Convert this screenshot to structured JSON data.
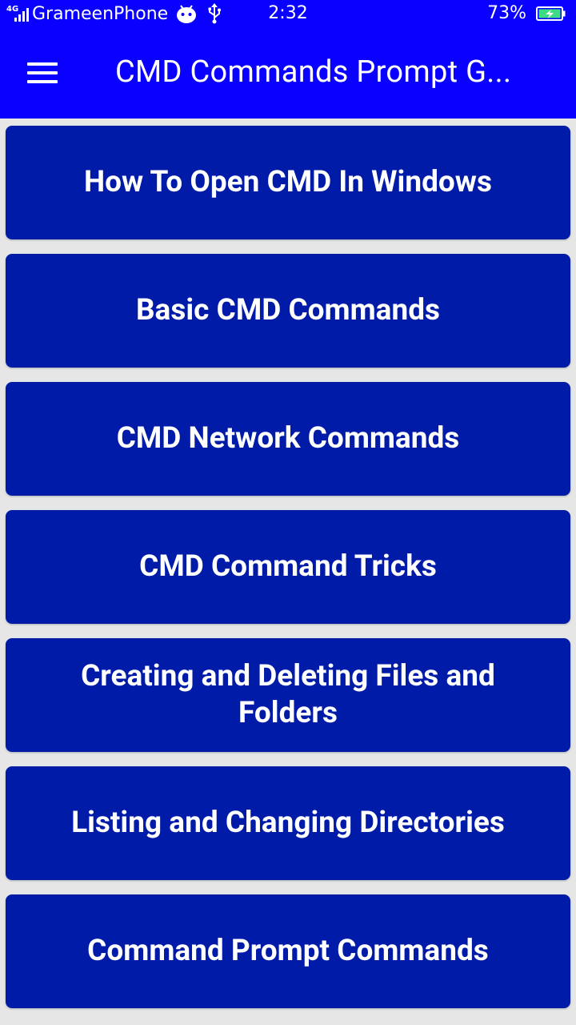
{
  "status_bar": {
    "network_type": "4G",
    "carrier": "GrameenPhone",
    "time": "2:32",
    "battery_percent": "73%",
    "icons": [
      "signal-icon",
      "android-icon",
      "usb-icon",
      "battery-charging-icon"
    ]
  },
  "app_bar": {
    "title": "CMD Commands Prompt G...",
    "menu_icon": "hamburger-menu-icon"
  },
  "menu_items": [
    {
      "label": "How To Open CMD In Windows"
    },
    {
      "label": "Basic CMD Commands"
    },
    {
      "label": "CMD Network Commands"
    },
    {
      "label": "CMD Command Tricks"
    },
    {
      "label": "Creating and Deleting Files and Folders"
    },
    {
      "label": "Listing and Changing Directories"
    },
    {
      "label": "Command Prompt Commands"
    }
  ],
  "colors": {
    "app_bar": "#0a00ff",
    "card": "#001ba7",
    "background": "#e6e6e6",
    "text": "#ffffff",
    "battery_fill": "#3ddc84"
  }
}
